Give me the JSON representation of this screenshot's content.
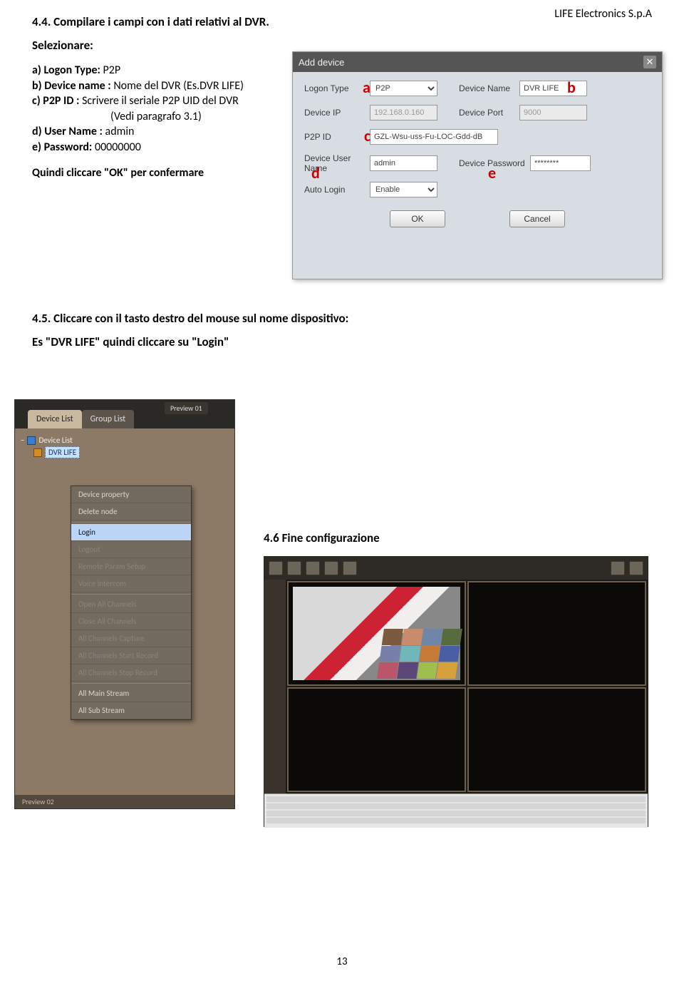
{
  "header_company": "LIFE Electronics S.p.A",
  "s44_title": "4.4. Compilare i campi con i dati relativi al DVR.",
  "selezionare": "Selezionare:",
  "items": {
    "a_prefix": "a) Logon Type: ",
    "a_value": "P2P",
    "b_prefix": "b) Device name : ",
    "b_value": "Nome del DVR (Es.DVR LIFE)",
    "c_prefix": "c) P2P ID : ",
    "c_value": "Scrivere il seriale P2P UID del DVR",
    "c_note": "(Vedi paragrafo 3.1)",
    "d_prefix": "d) User Name : ",
    "d_value": "admin",
    "e_prefix": "e) Password: ",
    "e_value": "00000000"
  },
  "confirm_text": "Quindi cliccare \"OK\" per confermare",
  "dialog": {
    "title": "Add device",
    "labels": {
      "logon_type": "Logon Type",
      "device_name": "Device Name",
      "device_ip": "Device IP",
      "device_port": "Device Port",
      "p2p_id": "P2P ID",
      "user_name": "Device User Name",
      "password": "Device Password",
      "auto_login": "Auto Login"
    },
    "values": {
      "logon_type": "P2P",
      "device_name": "DVR LIFE",
      "device_ip": "192.168.0.160",
      "device_port": "9000",
      "p2p_id": "GZL-Wsu-uss-Fu-LOC-Gdd-dB",
      "user_name": "admin",
      "password": "********",
      "auto_login": "Enable"
    },
    "ok": "OK",
    "cancel": "Cancel"
  },
  "anno": {
    "a": "a",
    "b": "b",
    "c": "c",
    "d": "d",
    "e": "e"
  },
  "s45_title": "4.5. Cliccare con il tasto destro del mouse sul nome dispositivo:",
  "s45_sub": " Es \"DVR LIFE\" quindi cliccare su \"Login\"",
  "ctx": {
    "tab_preview": "Preview 01",
    "tab_device": "Device List",
    "tab_group": "Group List",
    "root": "Device List",
    "node": "DVR LIFE",
    "menu": {
      "prop": "Device property",
      "delete": "Delete node",
      "login": "Login",
      "logout": "Logout",
      "remote": "Remote Param Setup",
      "voice": "Voice Intercom",
      "open_all": "Open All Channels",
      "close_all": "Close All Channels",
      "capture": "All Channels Capture",
      "start_rec": "All Channels Start Record",
      "stop_rec": "All Channels Stop Record",
      "main_stream": "All Main Stream",
      "sub_stream": "All Sub Stream"
    },
    "bottom": "Preview 02"
  },
  "s46_title": "4.6 Fine configurazione",
  "page_number": "13"
}
